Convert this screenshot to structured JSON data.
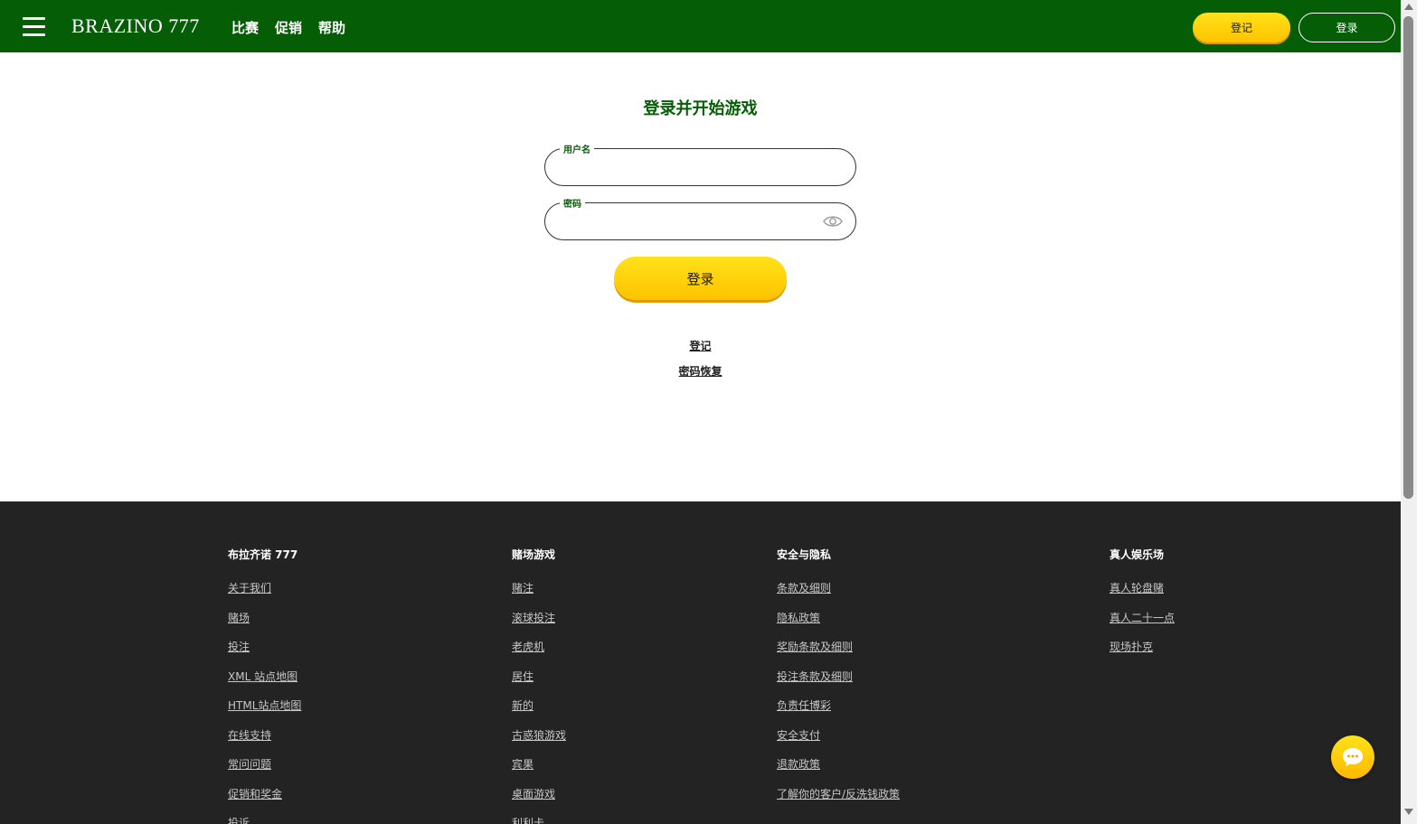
{
  "header": {
    "logo": "BRAZINO 777",
    "nav": [
      "比赛",
      "促销",
      "帮助"
    ],
    "register_label": "登记",
    "login_label": "登录"
  },
  "login": {
    "title": "登录并开始游戏",
    "username_label": "用户名",
    "username_value": "",
    "password_label": "密码",
    "password_value": "",
    "submit_label": "登录",
    "register_link": "登记",
    "recover_link": "密码恢复"
  },
  "footer": {
    "columns": [
      {
        "title": "布拉齐诺 777",
        "links": [
          "关于我们",
          "赌场",
          "投注",
          "XML 站点地图",
          "HTML站点地图",
          "在线支持",
          "常问问题",
          "促销和奖金",
          "投诉"
        ]
      },
      {
        "title": "赌场游戏",
        "links": [
          "赌注",
          "滚球投注",
          "老虎机",
          "居住",
          "新的",
          "古惑狼游戏",
          "宾果",
          "桌面游戏",
          "利利卡"
        ]
      },
      {
        "title": "安全与隐私",
        "links": [
          "条款及细则",
          "隐私政策",
          "奖励条款及细则",
          "投注条款及细则",
          "负责任博彩",
          "安全支付",
          "退款政策",
          "了解你的客户/反洗钱政策"
        ]
      },
      {
        "title": "真人娱乐场",
        "links": [
          "真人轮盘赌",
          "真人二十一点",
          "现场扑克"
        ]
      }
    ]
  },
  "colors": {
    "header_green": "#055d05",
    "accent_yellow": "#ffc200",
    "footer_bg": "#232323"
  },
  "icons": {
    "menu": "hamburger-icon",
    "eye": "eye-icon",
    "chat": "chat-icon"
  }
}
